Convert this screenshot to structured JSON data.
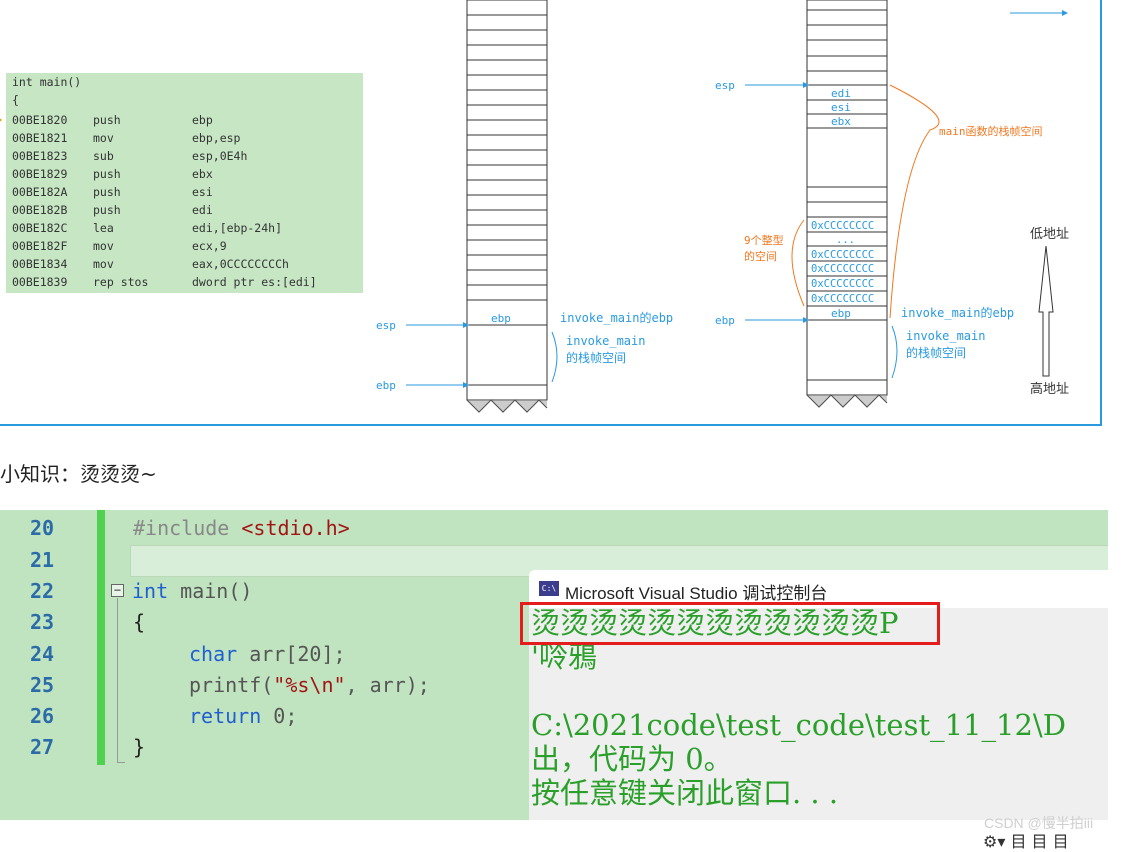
{
  "asm": {
    "header1": "int main()",
    "header2": "{",
    "rows": [
      {
        "addr": "00BE1820",
        "op": "push",
        "arg": "ebp"
      },
      {
        "addr": "00BE1821",
        "op": "mov",
        "arg": "ebp,esp"
      },
      {
        "addr": "00BE1823",
        "op": "sub",
        "arg": "esp,0E4h"
      },
      {
        "addr": "00BE1829",
        "op": "push",
        "arg": "ebx"
      },
      {
        "addr": "00BE182A",
        "op": "push",
        "arg": "esi"
      },
      {
        "addr": "00BE182B",
        "op": "push",
        "arg": "edi"
      },
      {
        "addr": "00BE182C",
        "op": "lea",
        "arg": "edi,[ebp-24h]"
      },
      {
        "addr": "00BE182F",
        "op": "mov",
        "arg": "ecx,9"
      },
      {
        "addr": "00BE1834",
        "op": "mov",
        "arg": "eax,0CCCCCCCCh"
      },
      {
        "addr": "00BE1839",
        "op": "rep stos",
        "arg": "dword ptr es:[edi]"
      }
    ]
  },
  "diagram": {
    "left_stack": {
      "esp": "esp",
      "ebp": "ebp",
      "cell_ebp": "ebp",
      "invoke_ebp": "invoke_main的ebp",
      "frame1": "invoke_main",
      "frame2": "的栈帧空间"
    },
    "right_stack": {
      "esp": "esp",
      "ebp": "ebp",
      "regs": [
        "edi",
        "esi",
        "ebx"
      ],
      "cc_cells": [
        "0xCCCCCCCC",
        "...",
        "0xCCCCCCCC",
        "0xCCCCCCCC",
        "0xCCCCCCCC",
        "0xCCCCCCCC"
      ],
      "cell_ebp": "ebp",
      "main_frame": "main函数的栈帧空间",
      "int_space1": "9个整型",
      "int_space2": "的空间",
      "invoke_ebp": "invoke_main的ebp",
      "frame1": "invoke_main",
      "frame2": "的栈帧空间"
    },
    "low_addr": "低地址",
    "high_addr": "高地址"
  },
  "note_heading": "小知识：烫烫烫~",
  "editor": {
    "line_numbers": [
      "20",
      "21",
      "22",
      "23",
      "24",
      "25",
      "26",
      "27"
    ],
    "include_kw": "#include",
    "include_file": "<stdio.h>",
    "int_kw": "int",
    "main_sig": " main()",
    "open_brace": "{",
    "char_kw": "char",
    "decl": " arr[20];",
    "printf_fn": "printf(",
    "fmt_str": "\"%s\\n\"",
    "printf_args": ", arr);",
    "return_kw": "return",
    "return_val": " 0;",
    "close_brace": "}"
  },
  "console": {
    "title": "Microsoft Visual Studio 调试控制台",
    "icon_text": "C:\\",
    "line1": "烫烫烫烫烫烫烫烫烫烫烫烫P",
    "line2": "'唥鴉",
    "line3": "",
    "line4": "C:\\2021code\\test_code\\test_11_12\\D",
    "line5": "出，代码为 0。",
    "line6": "按任意键关闭此窗口. . ."
  },
  "watermark": "CSDN @慢半拍iii",
  "bottom_icons": "⚙▾ 目 目 目"
}
